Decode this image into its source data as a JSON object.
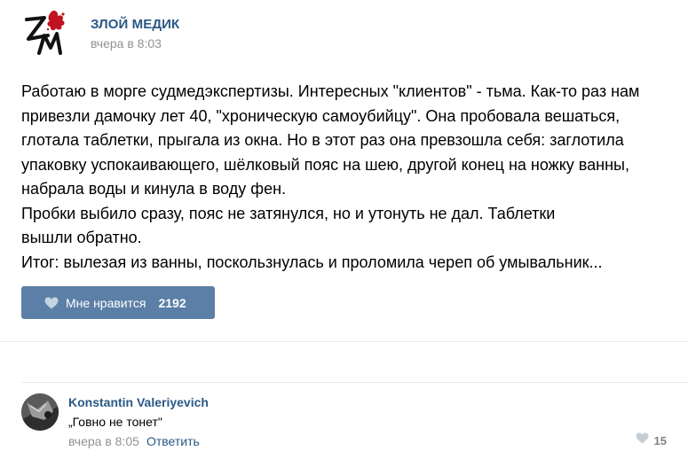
{
  "post": {
    "author": "ЗЛОЙ МЕДИК",
    "time": "вчера в 8:03",
    "logo_icon": "zm-logo-with-red-splash",
    "text_lines": [
      "Работаю в морге судмедэкспертизы. Интересных \"клиентов\" - тьма. Как-то раз нам",
      "привезли дамочку лет 40, \"хроническую самоубийцу\". Она пробовала вешаться,",
      "глотала таблетки, прыгала из окна. Но в этот раз она превзошла себя: заглотила",
      "упаковку успокаивающего, шёлковый пояс на шею, другой конец на ножку ванны,",
      "набрала воды и кинула в воду фен.",
      "Пробки выбило сразу, пояс не затянулся, но и утонуть не дал. Таблетки",
      "вышли обратно.",
      "Итог: вылезая из ванны, поскользнулась и проломила череп об умывальник..."
    ],
    "like": {
      "label": "Мне нравится",
      "count": "2192",
      "icon": "heart-icon"
    }
  },
  "comment": {
    "author": "Konstantin Valeriyevich",
    "text": "„Говно не тонет\"",
    "time": "вчера в 8:05",
    "reply_label": "Ответить",
    "like_count": "15",
    "like_icon": "heart-icon"
  },
  "colors": {
    "link": "#2a5885",
    "button": "#5b7fa6",
    "muted": "#939393",
    "divider": "#e7e8ec",
    "logo_red": "#c1121f"
  }
}
